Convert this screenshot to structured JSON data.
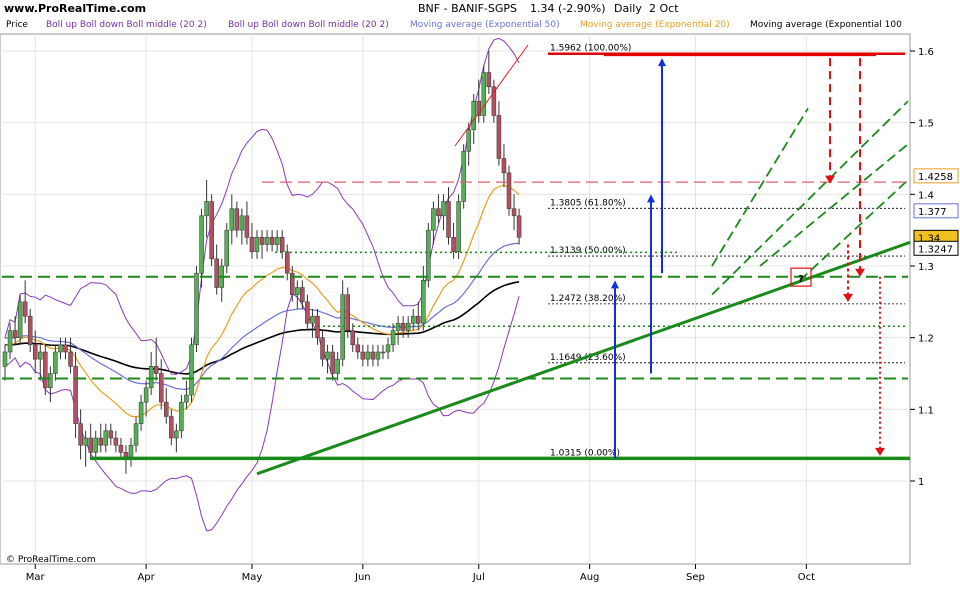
{
  "header": {
    "logo": "www.ProRealTime.com",
    "title": "BNF - BANIF-SGPS",
    "price_change": "1.34 (-2.90%)",
    "period": "Daily",
    "date": "2 Oct"
  },
  "legend": [
    {
      "label": "Price",
      "color": "#000000"
    },
    {
      "label": "Boll up Boll down Boll middle (20 2)",
      "color": "#7a2fa8"
    },
    {
      "label": "Boll up Boll down Boll middle (20 2)",
      "color": "#7a2fa8"
    },
    {
      "label": "Moving average (Exponential 50)",
      "color": "#6b72d8"
    },
    {
      "label": "Moving average (Exponential 20)",
      "color": "#e8a020"
    },
    {
      "label": "Moving average (Exponential 100",
      "color": "#000000"
    }
  ],
  "footer": {
    "copyright": "© ProRealTime.com"
  },
  "colors": {
    "up_candle": "#55b055",
    "down_candle": "#b05060",
    "boll": "#8a3ab8",
    "ema20": "#e8a020",
    "ema50": "#6b72d8",
    "ema100": "#000000",
    "trend": "#1a8a1a",
    "fib_top": "#e00000"
  },
  "chart_data": {
    "type": "candlestick",
    "ylim": [
      0.92,
      1.64
    ],
    "yticks": [
      1.0,
      1.1,
      1.2,
      1.3,
      1.4,
      1.5,
      1.6
    ],
    "ytick_labels": [
      "1",
      "1.1",
      "1.2",
      "1.3",
      "1.4",
      "1.5",
      "1.6"
    ],
    "x_months": [
      {
        "label": "Mar",
        "day": 6
      },
      {
        "label": "Apr",
        "day": 28
      },
      {
        "label": "May",
        "day": 49
      },
      {
        "label": "Jun",
        "day": 71
      },
      {
        "label": "Jul",
        "day": 94
      },
      {
        "label": "Aug",
        "day": 116
      },
      {
        "label": "Sep",
        "day": 137
      },
      {
        "label": "Oct",
        "day": 159
      }
    ],
    "price_tags": [
      {
        "value": 1.4258,
        "label": "1.4258",
        "color": "#e8a020"
      },
      {
        "value": 1.377,
        "label": "1.377",
        "color": "#6b72d8"
      },
      {
        "value": 1.34,
        "label": "1.34",
        "color": "#000000",
        "bg": "#f0c020"
      },
      {
        "value": 1.3247,
        "label": "1.3247",
        "color": "#000000"
      }
    ],
    "fibonacci": [
      {
        "value": 1.5962,
        "label": "1.5962 (100.00%)"
      },
      {
        "value": 1.3805,
        "label": "1.3805 (61.80%)"
      },
      {
        "value": 1.3139,
        "label": "1.3139 (50.00%)"
      },
      {
        "value": 1.2472,
        "label": "1.2472 (38.20%)"
      },
      {
        "value": 1.1649,
        "label": "1.1649 (23.60%)"
      },
      {
        "value": 1.0315,
        "label": "1.0315 (0.00%)"
      }
    ],
    "annotation_mark": "?",
    "candles": [
      [
        1.16,
        1.19,
        1.14,
        1.18
      ],
      [
        1.18,
        1.22,
        1.17,
        1.21
      ],
      [
        1.21,
        1.23,
        1.19,
        1.2
      ],
      [
        1.2,
        1.26,
        1.19,
        1.25
      ],
      [
        1.25,
        1.28,
        1.22,
        1.23
      ],
      [
        1.23,
        1.24,
        1.18,
        1.19
      ],
      [
        1.19,
        1.21,
        1.15,
        1.17
      ],
      [
        1.17,
        1.19,
        1.14,
        1.18
      ],
      [
        1.18,
        1.19,
        1.12,
        1.13
      ],
      [
        1.13,
        1.16,
        1.11,
        1.15
      ],
      [
        1.15,
        1.19,
        1.14,
        1.18
      ],
      [
        1.18,
        1.2,
        1.17,
        1.19
      ],
      [
        1.19,
        1.2,
        1.17,
        1.18
      ],
      [
        1.18,
        1.2,
        1.15,
        1.16
      ],
      [
        1.16,
        1.18,
        1.06,
        1.08
      ],
      [
        1.08,
        1.1,
        1.03,
        1.05
      ],
      [
        1.05,
        1.07,
        1.02,
        1.06
      ],
      [
        1.06,
        1.08,
        1.03,
        1.04
      ],
      [
        1.04,
        1.07,
        1.03,
        1.06
      ],
      [
        1.06,
        1.08,
        1.04,
        1.05
      ],
      [
        1.05,
        1.08,
        1.04,
        1.07
      ],
      [
        1.07,
        1.08,
        1.05,
        1.06
      ],
      [
        1.06,
        1.07,
        1.04,
        1.05
      ],
      [
        1.05,
        1.06,
        1.03,
        1.04
      ],
      [
        1.04,
        1.05,
        1.01,
        1.03
      ],
      [
        1.03,
        1.06,
        1.02,
        1.05
      ],
      [
        1.05,
        1.09,
        1.04,
        1.08
      ],
      [
        1.08,
        1.12,
        1.07,
        1.11
      ],
      [
        1.11,
        1.14,
        1.09,
        1.13
      ],
      [
        1.13,
        1.18,
        1.12,
        1.16
      ],
      [
        1.16,
        1.2,
        1.14,
        1.15
      ],
      [
        1.15,
        1.17,
        1.1,
        1.11
      ],
      [
        1.11,
        1.13,
        1.08,
        1.09
      ],
      [
        1.09,
        1.1,
        1.05,
        1.06
      ],
      [
        1.06,
        1.08,
        1.04,
        1.07
      ],
      [
        1.07,
        1.12,
        1.06,
        1.11
      ],
      [
        1.11,
        1.14,
        1.1,
        1.12
      ],
      [
        1.12,
        1.2,
        1.11,
        1.19
      ],
      [
        1.19,
        1.3,
        1.18,
        1.29
      ],
      [
        1.29,
        1.38,
        1.27,
        1.37
      ],
      [
        1.37,
        1.42,
        1.34,
        1.39
      ],
      [
        1.39,
        1.4,
        1.3,
        1.31
      ],
      [
        1.31,
        1.33,
        1.26,
        1.27
      ],
      [
        1.27,
        1.31,
        1.25,
        1.3
      ],
      [
        1.3,
        1.36,
        1.29,
        1.35
      ],
      [
        1.35,
        1.4,
        1.33,
        1.38
      ],
      [
        1.38,
        1.39,
        1.34,
        1.35
      ],
      [
        1.35,
        1.38,
        1.33,
        1.37
      ],
      [
        1.37,
        1.39,
        1.33,
        1.34
      ],
      [
        1.34,
        1.36,
        1.31,
        1.32
      ],
      [
        1.32,
        1.35,
        1.31,
        1.34
      ],
      [
        1.34,
        1.35,
        1.31,
        1.33
      ],
      [
        1.33,
        1.35,
        1.32,
        1.34
      ],
      [
        1.34,
        1.35,
        1.32,
        1.33
      ],
      [
        1.33,
        1.35,
        1.32,
        1.34
      ],
      [
        1.34,
        1.35,
        1.31,
        1.32
      ],
      [
        1.32,
        1.33,
        1.28,
        1.29
      ],
      [
        1.29,
        1.3,
        1.25,
        1.26
      ],
      [
        1.26,
        1.28,
        1.24,
        1.27
      ],
      [
        1.27,
        1.28,
        1.24,
        1.25
      ],
      [
        1.25,
        1.26,
        1.21,
        1.22
      ],
      [
        1.22,
        1.24,
        1.2,
        1.23
      ],
      [
        1.23,
        1.24,
        1.19,
        1.2
      ],
      [
        1.2,
        1.21,
        1.16,
        1.17
      ],
      [
        1.17,
        1.19,
        1.15,
        1.18
      ],
      [
        1.18,
        1.19,
        1.14,
        1.15
      ],
      [
        1.15,
        1.18,
        1.14,
        1.17
      ],
      [
        1.17,
        1.28,
        1.16,
        1.26
      ],
      [
        1.26,
        1.27,
        1.2,
        1.21
      ],
      [
        1.21,
        1.22,
        1.18,
        1.19
      ],
      [
        1.19,
        1.2,
        1.17,
        1.18
      ],
      [
        1.18,
        1.19,
        1.16,
        1.17
      ],
      [
        1.17,
        1.19,
        1.16,
        1.18
      ],
      [
        1.18,
        1.19,
        1.16,
        1.17
      ],
      [
        1.17,
        1.19,
        1.16,
        1.18
      ],
      [
        1.18,
        1.19,
        1.17,
        1.18
      ],
      [
        1.18,
        1.2,
        1.17,
        1.19
      ],
      [
        1.19,
        1.22,
        1.18,
        1.21
      ],
      [
        1.21,
        1.23,
        1.19,
        1.22
      ],
      [
        1.22,
        1.23,
        1.2,
        1.21
      ],
      [
        1.21,
        1.23,
        1.2,
        1.22
      ],
      [
        1.22,
        1.24,
        1.21,
        1.23
      ],
      [
        1.23,
        1.25,
        1.21,
        1.22
      ],
      [
        1.22,
        1.3,
        1.21,
        1.28
      ],
      [
        1.28,
        1.36,
        1.27,
        1.35
      ],
      [
        1.35,
        1.39,
        1.33,
        1.38
      ],
      [
        1.38,
        1.4,
        1.36,
        1.37
      ],
      [
        1.37,
        1.4,
        1.35,
        1.39
      ],
      [
        1.39,
        1.41,
        1.33,
        1.34
      ],
      [
        1.34,
        1.36,
        1.31,
        1.32
      ],
      [
        1.32,
        1.4,
        1.31,
        1.39
      ],
      [
        1.39,
        1.47,
        1.38,
        1.46
      ],
      [
        1.46,
        1.5,
        1.44,
        1.49
      ],
      [
        1.49,
        1.54,
        1.47,
        1.53
      ],
      [
        1.53,
        1.56,
        1.5,
        1.51
      ],
      [
        1.51,
        1.58,
        1.5,
        1.57
      ],
      [
        1.57,
        1.6,
        1.54,
        1.55
      ],
      [
        1.55,
        1.56,
        1.5,
        1.51
      ],
      [
        1.51,
        1.53,
        1.44,
        1.45
      ],
      [
        1.45,
        1.47,
        1.41,
        1.43
      ],
      [
        1.43,
        1.44,
        1.37,
        1.38
      ],
      [
        1.38,
        1.4,
        1.35,
        1.37
      ],
      [
        1.37,
        1.38,
        1.33,
        1.34
      ]
    ]
  }
}
